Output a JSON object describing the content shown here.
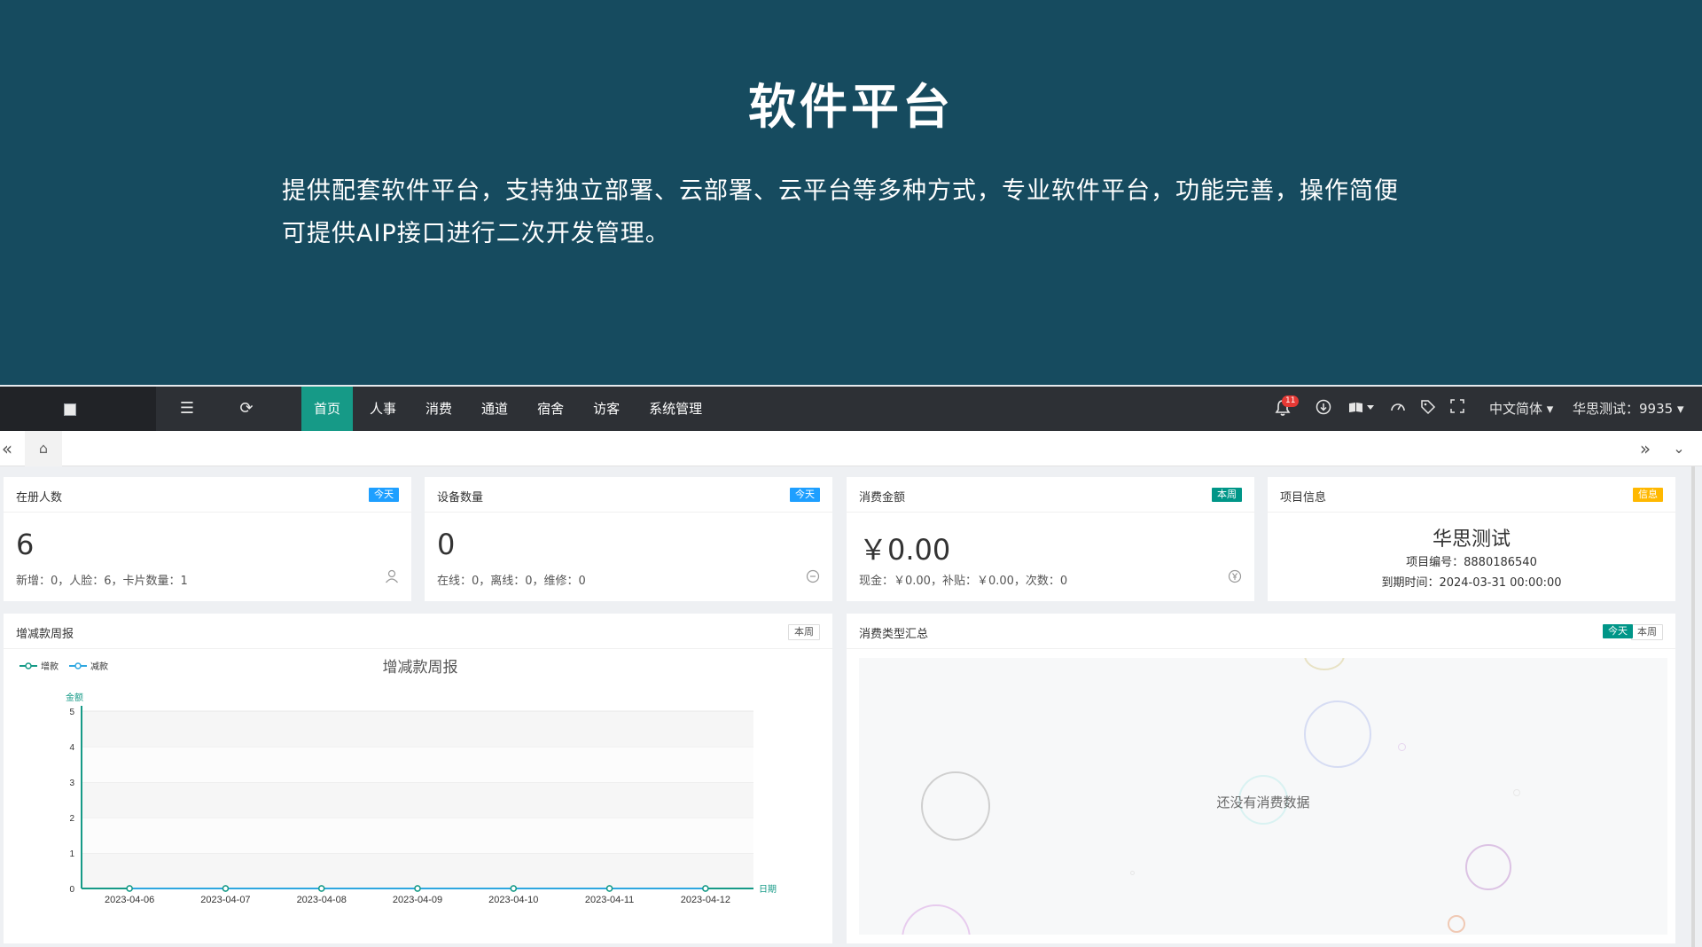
{
  "hero": {
    "title": "软件平台",
    "desc_line1": "提供配套软件平台，支持独立部署、云部署、云平台等多种方式，专业软件平台，功能完善，操作简便",
    "desc_line2": "可提供AIP接口进行二次开发管理。"
  },
  "topbar": {
    "nav": [
      "首页",
      "人事",
      "消费",
      "通道",
      "宿舍",
      "访客",
      "系统管理"
    ],
    "notif_count": "11",
    "language": "中文简体",
    "user": "华思测试：9935"
  },
  "cards": {
    "registered": {
      "title": "在册人数",
      "tag": "今天",
      "value": "6",
      "sub": "新增：0，人脸：6，卡片数量：1"
    },
    "devices": {
      "title": "设备数量",
      "tag": "今天",
      "value": "0",
      "sub": "在线：0，离线：0，维修：0"
    },
    "spend": {
      "title": "消费金额",
      "tag": "本周",
      "value": "￥0.00",
      "sub": "现金：￥0.00，补贴：￥0.00，次数：0"
    },
    "project": {
      "title": "项目信息",
      "tag": "信息",
      "name": "华思测试",
      "code": "项目编号：8880186540",
      "expire": "到期时间：2024-03-31 00:00:00"
    }
  },
  "weekly_panel": {
    "title": "增减款周报",
    "tag": "本周"
  },
  "type_panel": {
    "title": "消费类型汇总",
    "tag_today": "今天",
    "tag_week": "本周",
    "empty": "还没有消费数据"
  },
  "chart_data": {
    "type": "line",
    "title": "增减款周报",
    "xlabel": "日期",
    "ylabel": "金额",
    "categories": [
      "2023-04-06",
      "2023-04-07",
      "2023-04-08",
      "2023-04-09",
      "2023-04-10",
      "2023-04-11",
      "2023-04-12"
    ],
    "series": [
      {
        "name": "增款",
        "values": [
          0,
          0,
          0,
          0,
          0,
          0,
          0
        ]
      },
      {
        "name": "减款",
        "values": [
          0,
          0,
          0,
          0,
          0,
          0,
          0
        ]
      }
    ],
    "ylim": [
      0,
      5
    ],
    "yticks": [
      0,
      1,
      2,
      3,
      4,
      5
    ],
    "legend": "top-left",
    "grid": true,
    "colors": [
      "#169a87",
      "#2ea7e0"
    ]
  }
}
